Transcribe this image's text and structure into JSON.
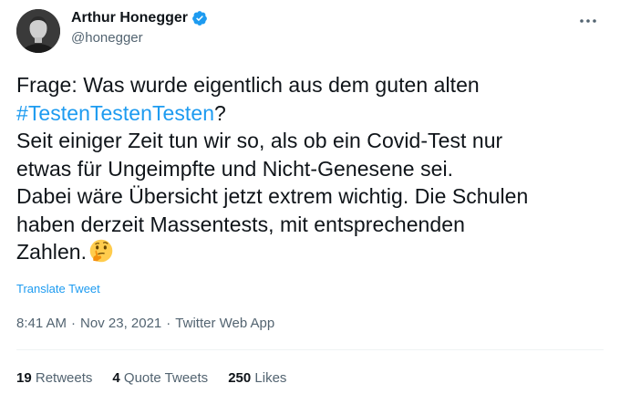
{
  "author": {
    "display_name": "Arthur Honegger",
    "handle": "@honegger",
    "verified_icon": "verified-badge-icon",
    "verified_color": "#1d9bf0"
  },
  "tweet": {
    "line1": "Frage: Was wurde eigentlich aus dem guten alten",
    "hashtag": "#TestenTestenTesten",
    "hashtag_suffix": "?",
    "body": "Seit einiger Zeit tun wir so, als ob ein Covid-Test nur\netwas für Ungeimpfte und Nicht-Genesene sei.\nDabei wäre Übersicht jetzt extrem wichtig. Die Schulen\nhaben derzeit Massentests, mit entsprechenden\nZahlen.",
    "emoji": "thinking-face-icon"
  },
  "translate_label": "Translate Tweet",
  "meta": {
    "time": "8:41 AM",
    "sep1": "·",
    "date": "Nov 23, 2021",
    "sep2": "·",
    "source": "Twitter Web App"
  },
  "stats": [
    {
      "count": "19",
      "label": "Retweets"
    },
    {
      "count": "4",
      "label": "Quote Tweets"
    },
    {
      "count": "250",
      "label": "Likes"
    }
  ],
  "colors": {
    "text": "#0f1419",
    "secondary": "#536471",
    "link": "#1d9bf0"
  }
}
